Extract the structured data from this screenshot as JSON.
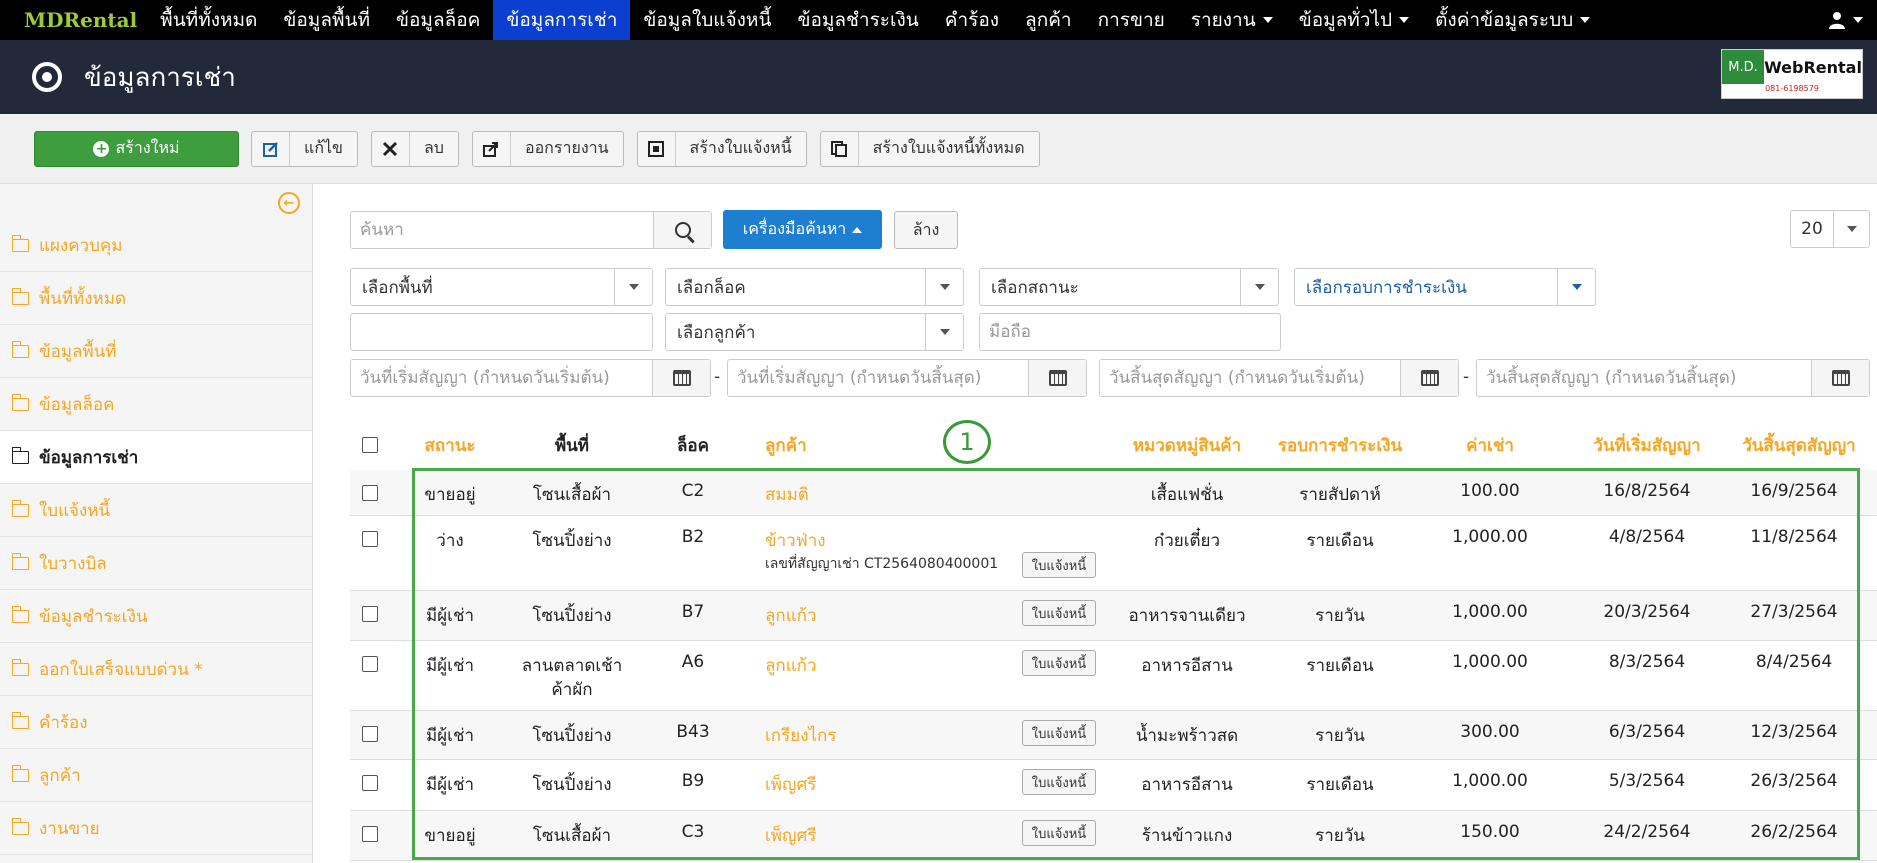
{
  "nav": {
    "brand": "MDRental",
    "items": [
      {
        "label": "พื้นที่ทั้งหมด",
        "dropdown": false
      },
      {
        "label": "ข้อมูลพื้นที่",
        "dropdown": false
      },
      {
        "label": "ข้อมูลล็อค",
        "dropdown": false
      },
      {
        "label": "ข้อมูลการเช่า",
        "dropdown": false,
        "active": true
      },
      {
        "label": "ข้อมูลใบแจ้งหนี้",
        "dropdown": false
      },
      {
        "label": "ข้อมูลชำระเงิน",
        "dropdown": false
      },
      {
        "label": "คำร้อง",
        "dropdown": false
      },
      {
        "label": "ลูกค้า",
        "dropdown": false
      },
      {
        "label": "การขาย",
        "dropdown": false
      },
      {
        "label": "รายงาน",
        "dropdown": true
      },
      {
        "label": "ข้อมูลทั่วไป",
        "dropdown": true
      },
      {
        "label": "ตั้งค่าข้อมูลระบบ",
        "dropdown": true
      }
    ],
    "user_icon": "user-icon"
  },
  "header": {
    "title": "ข้อมูลการเช่า",
    "logo": {
      "md": "M.D.",
      "name": "WebRental",
      "phone": "081-6198579"
    }
  },
  "toolbar": {
    "create": "สร้างใหม่",
    "edit": "แก้ไข",
    "delete": "ลบ",
    "export": "ออกรายงาน",
    "create_invoice": "สร้างใบแจ้งหนี้",
    "create_all_invoices": "สร้างใบแจ้งหนี้ทั้งหมด"
  },
  "sidebar": {
    "items": [
      {
        "label": "แผงควบคุม"
      },
      {
        "label": "พื้นที่ทั้งหมด"
      },
      {
        "label": "ข้อมูลพื้นที่"
      },
      {
        "label": "ข้อมูลล็อค"
      },
      {
        "label": "ข้อมูลการเช่า",
        "active": true
      },
      {
        "label": "ใบแจ้งหนี้"
      },
      {
        "label": "ใบวางบิล"
      },
      {
        "label": "ข้อมูลชำระเงิน"
      },
      {
        "label": "ออกใบเสร็จแบบด่วน *"
      },
      {
        "label": "คำร้อง"
      },
      {
        "label": "ลูกค้า"
      },
      {
        "label": "งานขาย"
      }
    ]
  },
  "filters": {
    "search_placeholder": "ค้นหา",
    "tools_button": "เครื่องมือค้นหา",
    "clear_button": "ล้าง",
    "page_size": "20",
    "select_area": "เลือกพื้นที่",
    "select_lock": "เลือกล็อค",
    "select_status": "เลือกสถานะ",
    "select_payment_cycle": "เลือกรอบการชำระเงิน",
    "select_customer": "เลือกลูกค้า",
    "mobile_placeholder": "มือถือ",
    "start_from_placeholder": "วันที่เริ่มสัญญา (กำหนดวันเริ่มต้น)",
    "start_to_placeholder": "วันที่เริ่มสัญญา (กำหนดวันสิ้นสุด)",
    "end_from_placeholder": "วันสิ้นสุดสัญญา (กำหนดวันเริ่มต้น)",
    "end_to_placeholder": "วันสิ้นสุดสัญญา (กำหนดวันสิ้นสุด)",
    "dash": "-"
  },
  "table": {
    "headers": {
      "status": "สถานะ",
      "area": "พื้นที่",
      "lock": "ล็อค",
      "customer": "ลูกค้า",
      "category": "หมวดหมู่สินค้า",
      "payment_cycle": "รอบการชำระเงิน",
      "rent": "ค่าเช่า",
      "start_date": "วันที่เริ่มสัญญา",
      "end_date": "วันสิ้นสุดสัญญา"
    },
    "invoice_label": "ใบแจ้งหนี้",
    "rows": [
      {
        "status": "ขายอยู่",
        "area": "โซนเสื้อผ้า",
        "lock": "C2",
        "customer": "สมมติ",
        "contract": "",
        "invoice": false,
        "category": "เสื้อแฟชั่น",
        "cycle": "รายสัปดาห์",
        "rent": "100.00",
        "start": "16/8/2564",
        "end": "16/9/2564"
      },
      {
        "status": "ว่าง",
        "area": "โซนปิ้งย่าง",
        "lock": "B2",
        "customer": "ข้าวฟ่าง",
        "contract": "เลขที่สัญญาเช่า CT2564080400001",
        "invoice": true,
        "category": "ก๋วยเตี๋ยว",
        "cycle": "รายเดือน",
        "rent": "1,000.00",
        "start": "4/8/2564",
        "end": "11/8/2564"
      },
      {
        "status": "มีผู้เช่า",
        "area": "โซนปิ้งย่าง",
        "lock": "B7",
        "customer": "ลูกแก้ว",
        "contract": "",
        "invoice": true,
        "category": "อาหารจานเดียว",
        "cycle": "รายวัน",
        "rent": "1,000.00",
        "start": "20/3/2564",
        "end": "27/3/2564"
      },
      {
        "status": "มีผู้เช่า",
        "area": "ลานตลาดเช้า",
        "area2": "ค้าผัก",
        "lock": "A6",
        "customer": "ลูกแก้ว",
        "contract": "",
        "invoice": true,
        "category": "อาหารอีสาน",
        "cycle": "รายเดือน",
        "rent": "1,000.00",
        "start": "8/3/2564",
        "end": "8/4/2564"
      },
      {
        "status": "มีผู้เช่า",
        "area": "โซนปิ้งย่าง",
        "lock": "B43",
        "customer": "เกรียงไกร",
        "contract": "",
        "invoice": true,
        "category": "น้ำมะพร้าวสด",
        "cycle": "รายวัน",
        "rent": "300.00",
        "start": "6/3/2564",
        "end": "12/3/2564"
      },
      {
        "status": "มีผู้เช่า",
        "area": "โซนปิ้งย่าง",
        "lock": "B9",
        "customer": "เพ็ญศรี",
        "contract": "",
        "invoice": true,
        "category": "อาหารอีสาน",
        "cycle": "รายเดือน",
        "rent": "1,000.00",
        "start": "5/3/2564",
        "end": "26/3/2564"
      },
      {
        "status": "ขายอยู่",
        "area": "โซนเสื้อผ้า",
        "lock": "C3",
        "customer": "เพ็ญศรี",
        "contract": "",
        "invoice": true,
        "category": "ร้านข้าวแกง",
        "cycle": "รายวัน",
        "rent": "150.00",
        "start": "24/2/2564",
        "end": "26/2/2564"
      }
    ]
  },
  "annotation": {
    "marker": "1"
  }
}
